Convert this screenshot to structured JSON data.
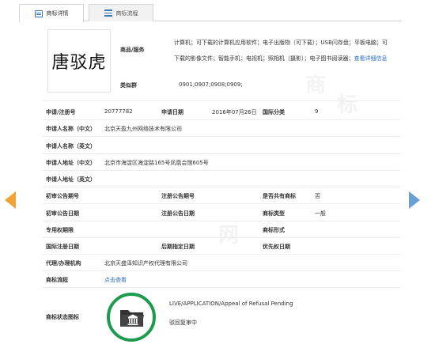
{
  "tabs": [
    {
      "label": "商标详情",
      "active": true
    },
    {
      "label": "商标流程",
      "active": false
    }
  ],
  "trademark": {
    "image_text": "唐驳虎"
  },
  "goods": {
    "label": "商品/服务",
    "line1": "计算机；可下载的计算机应用软件；电子出版物（可下载）；USB闪存盘；平板电脑；可",
    "line2": "下载的影像文件；智能手机；电视机；照相机（摄影）；电子图书阅读器；",
    "more_link": "查看详细信息"
  },
  "groups": {
    "label": "类似群",
    "value": "0901;0907;0908;0909;"
  },
  "rows": {
    "reg_no_label": "申请/注册号",
    "reg_no_value": "20777782",
    "apply_date_label": "申请日期",
    "apply_date_value": "2016年07月26日",
    "class_label": "国际分类",
    "class_value": "9",
    "applicant_cn_label": "申请人名称（中文）",
    "applicant_cn_value": "北京天盈九州网络技术有限公司",
    "applicant_en_label": "申请人名称（英文）",
    "address_cn_label": "申请人地址（中文）",
    "address_cn_value": "北京市海淀区海淀路165号凤凰会馆605号",
    "address_en_label": "申请人地址（英文）",
    "first_pub_no_label": "初审公告期号",
    "reg_pub_no_label": "注册公告期号",
    "shared_label": "是否共有商标",
    "shared_value": "否",
    "first_pub_date_label": "初审公告日期",
    "reg_pub_date_label": "注册公告日期",
    "type_label": "商标类型",
    "type_value": "一般",
    "exclusive_label": "专用权期限",
    "form_label": "商标形式",
    "intl_reg_label": "国际注册日期",
    "later_date_label": "后期指定日期",
    "priority_label": "优先权日期",
    "agent_label": "代理/办理机构",
    "agent_value": "北京天盛泽知识产权代理有限公司",
    "flow_label": "商标流程",
    "flow_link": "点击查看",
    "status_label": "商标状态图标"
  },
  "status": {
    "en": "LIVE/APPLICATION/Appeal of Refusal Pending",
    "cn": "驳回复审中",
    "ring_color": "#1e9a4f"
  },
  "watermark": [
    "商",
    "标",
    "网"
  ]
}
